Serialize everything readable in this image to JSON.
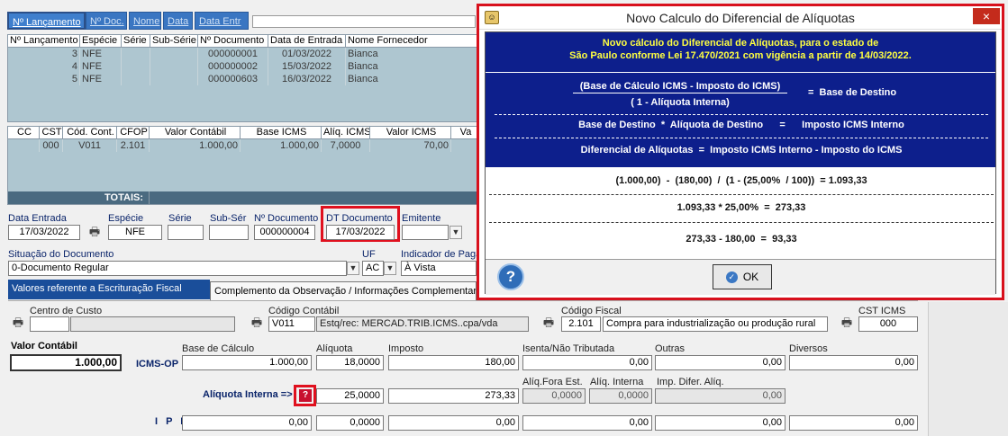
{
  "toolbar": {
    "tabs": [
      "Nº Lançamento",
      "Nº Doc.",
      "Nome",
      "Data",
      "Data Entr"
    ]
  },
  "top_grid": {
    "headers": [
      "Nº Lançamento",
      "Espécie",
      "Série",
      "Sub-Série",
      "Nº Documento",
      "Data de Entrada",
      "Nome Fornecedor"
    ],
    "rows": [
      [
        "3",
        "NFE",
        "",
        "",
        "000000001",
        "01/03/2022",
        "Bianca"
      ],
      [
        "4",
        "NFE",
        "",
        "",
        "000000002",
        "15/03/2022",
        "Bianca"
      ],
      [
        "5",
        "NFE",
        "",
        "",
        "000000603",
        "16/03/2022",
        "Bianca"
      ]
    ]
  },
  "items_grid": {
    "headers": [
      "CC",
      "CST",
      "Cód. Cont.",
      "CFOP",
      "Valor Contábil",
      "Base ICMS",
      "Alíq. ICMS",
      "Valor ICMS",
      "Va"
    ],
    "row": [
      "",
      "000",
      "V011",
      "2.101",
      "1.000,00",
      "1.000,00",
      "7,0000",
      "70,00",
      ""
    ],
    "totals_label": "TOTAIS:"
  },
  "doc": {
    "data_entrada_label": "Data Entrada",
    "data_entrada": "17/03/2022",
    "especie_label": "Espécie",
    "especie": "NFE",
    "serie_label": "Série",
    "serie": "",
    "subser_label": "Sub-Sér",
    "subser": "",
    "ndoc_label": "Nº Documento",
    "ndoc": "000000004",
    "dtdoc_label": "DT Documento",
    "dtdoc": "17/03/2022",
    "emitente_label": "Emitente",
    "emitente": "",
    "situacao_label": "Situação do Documento",
    "situacao": "0-Documento Regular",
    "uf_label": "UF",
    "uf": "AC",
    "indicador_label": "Indicador de Paga",
    "indicador": "À Vista"
  },
  "tabs2": {
    "tab1": "Valores referente a Escrituração Fiscal",
    "tab2": "Complemento da Observação / Informações Complementares"
  },
  "fiscal": {
    "cc_label": "Centro de Custo",
    "cc": "",
    "cc_desc": "",
    "cod_cont_label": "Código Contábil",
    "cod_cont": "V011",
    "cod_cont_desc": "Estq/rec: MERCAD.TRIB.ICMS..cpa/vda",
    "cfop_label": "Código Fiscal",
    "cfop": "2.101",
    "cfop_desc": "Compra para industrialização ou produção rural",
    "cst_label": "CST ICMS",
    "cst": "000",
    "valor_contabil_label": "Valor Contábil",
    "valor_contabil": "1.000,00",
    "icms_op_label": "ICMS-OP",
    "base_label": "Base de Cálculo",
    "base": "1.000,00",
    "aliq_label": "Alíquota",
    "aliq": "18,0000",
    "imposto_label": "Imposto",
    "imposto": "180,00",
    "isenta_label": "Isenta/Não Tributada",
    "isenta": "0,00",
    "outras_label": "Outras",
    "outras": "0,00",
    "diversos_label": "Diversos",
    "diversos": "0,00",
    "aliq_fora_label": "Alíq.Fora Est.",
    "aliq_fora": "0,0000",
    "aliq_interna_small_label": "Alíq. Interna",
    "aliq_interna_small": "0,0000",
    "imp_difer_label": "Imp. Difer. Alíq.",
    "imp_difer": "0,00",
    "aliq_interna_label": "Alíquota Interna =>",
    "help_glyph": "?",
    "aliq_interna": "25,0000",
    "imposto_interno": "273,33",
    "ipi_label": "I P I",
    "ipi_base": "0,00",
    "ipi_aliq": "0,0000",
    "ipi_imposto": "0,00",
    "ipi_isenta": "0,00",
    "ipi_outras": "0,00",
    "ipi_diversos": "0,00"
  },
  "dialog": {
    "title": "Novo Calculo do Diferencial de Alíquotas",
    "close": "×",
    "intro1": "Novo cálculo do Diferencial de Alíquotas, para o estado de",
    "intro2": "São Paulo conforme Lei 17.470/2021 com vigência a partir de 14/03/2022.",
    "f1_num": "(Base de Cálculo ICMS - Imposto do ICMS)",
    "f1_den": "( 1 - Alíquota Interna)",
    "f1_eq": "=  Base de Destino",
    "f2": "Base de Destino  *  Alíquota de Destino      =      Imposto ICMS Interno",
    "f3": "Diferencial de Alíquotas  =  Imposto ICMS Interno - Imposto do ICMS",
    "c1": "(1.000,00)  -  (180,00)  /  (1 - (25,00%  / 100))  = 1.093,33",
    "c2": "1.093,33 * 25,00%  =  273,33",
    "c3": "273,33 - 180,00  =  93,33",
    "help": "?",
    "ok": "OK"
  },
  "colors": {
    "accent_red": "#e0101e",
    "navy": "#0d1f8c",
    "tab_blue": "#3a76c2"
  }
}
